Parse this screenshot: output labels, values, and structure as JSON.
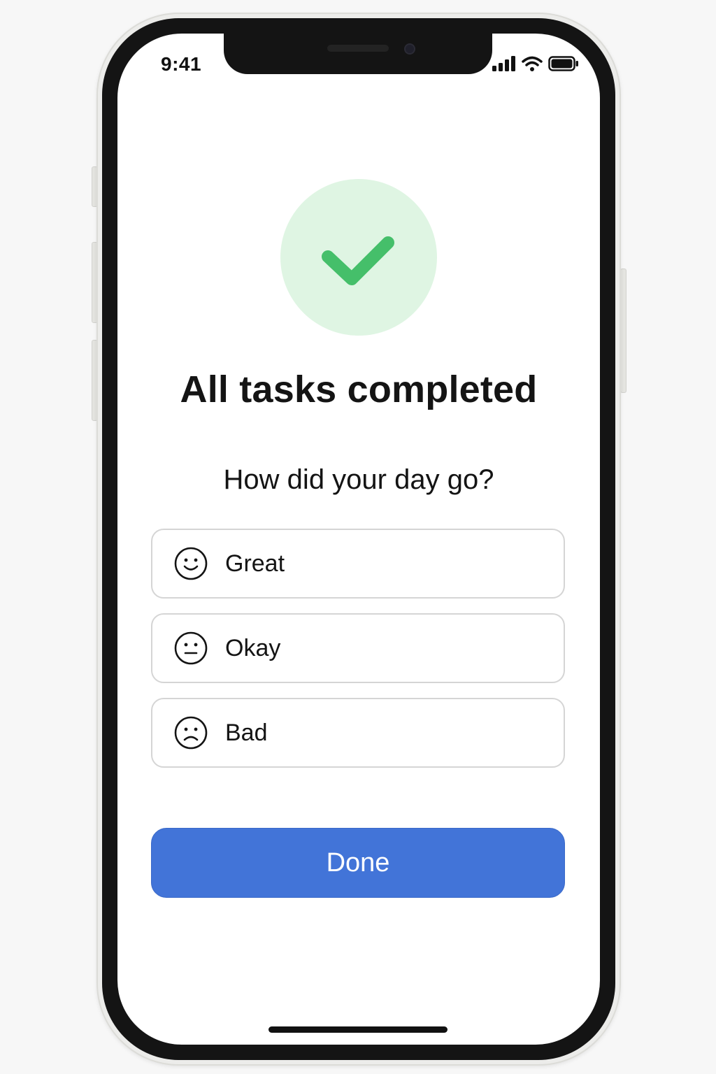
{
  "status_bar": {
    "time": "9:41",
    "icons": [
      "signal-icon",
      "wifi-icon",
      "battery-icon"
    ]
  },
  "success_icon": {
    "name": "checkmark-icon",
    "circle_color": "#dff5e3",
    "check_color": "#45bf6a"
  },
  "main": {
    "title": "All tasks completed",
    "question": "How did your day go?"
  },
  "mood_options": [
    {
      "label": "Great",
      "icon": "smiley-face-icon"
    },
    {
      "label": "Okay",
      "icon": "neutral-face-icon"
    },
    {
      "label": "Bad",
      "icon": "sad-face-icon"
    }
  ],
  "done_button": {
    "label": "Done",
    "color": "#4274d8"
  }
}
